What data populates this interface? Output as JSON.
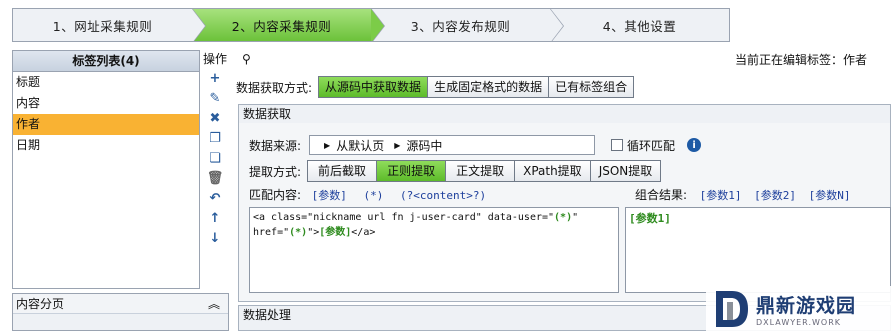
{
  "steps": [
    "1、网址采集规则",
    "2、内容采集规则",
    "3、内容发布规则",
    "4、其他设置"
  ],
  "tag_panel": {
    "title": "标签列表(4)",
    "tags": [
      "标题",
      "内容",
      "作者",
      "日期"
    ],
    "selected": "作者"
  },
  "ops_label": "操作",
  "page_panel": {
    "title": "内容分页"
  },
  "editing_label": "当前正在编辑标签：作者",
  "method": {
    "label": "数据获取方式:",
    "options": [
      "从源码中获取数据",
      "生成固定格式的数据",
      "已有标签组合"
    ],
    "selected": "从源码中获取数据"
  },
  "fetch": {
    "title": "数据获取",
    "source_label": "数据来源:",
    "source_parts": [
      "从默认页",
      "源码中"
    ],
    "loop_label": "循环匹配",
    "extract_label": "提取方式:",
    "extract_options": [
      "前后截取",
      "正则提取",
      "正文提取",
      "XPath提取",
      "JSON提取"
    ],
    "extract_selected": "正则提取",
    "match_label": "匹配内容:",
    "match_tokens": [
      "[参数]",
      "(*)",
      "(?<content>?)"
    ],
    "combo_label": "组合结果:",
    "combo_tokens": [
      "[参数1]",
      "[参数2]",
      "[参数N]"
    ],
    "code_line1": "<a class=\"nickname url fn j-user-card\" data-user=\"",
    "code_wild": "(*)",
    "code_q": "\"",
    "code_line2a": "href=\"",
    "code_line2b": "(*)",
    "code_line2c": "\">",
    "code_param": "[参数]",
    "code_end": "</a>",
    "combo_result": "[参数1]"
  },
  "process_title": "数据处理",
  "watermark": {
    "name": "鼎新游戏园",
    "url": "DXLAWYER.WORK"
  }
}
